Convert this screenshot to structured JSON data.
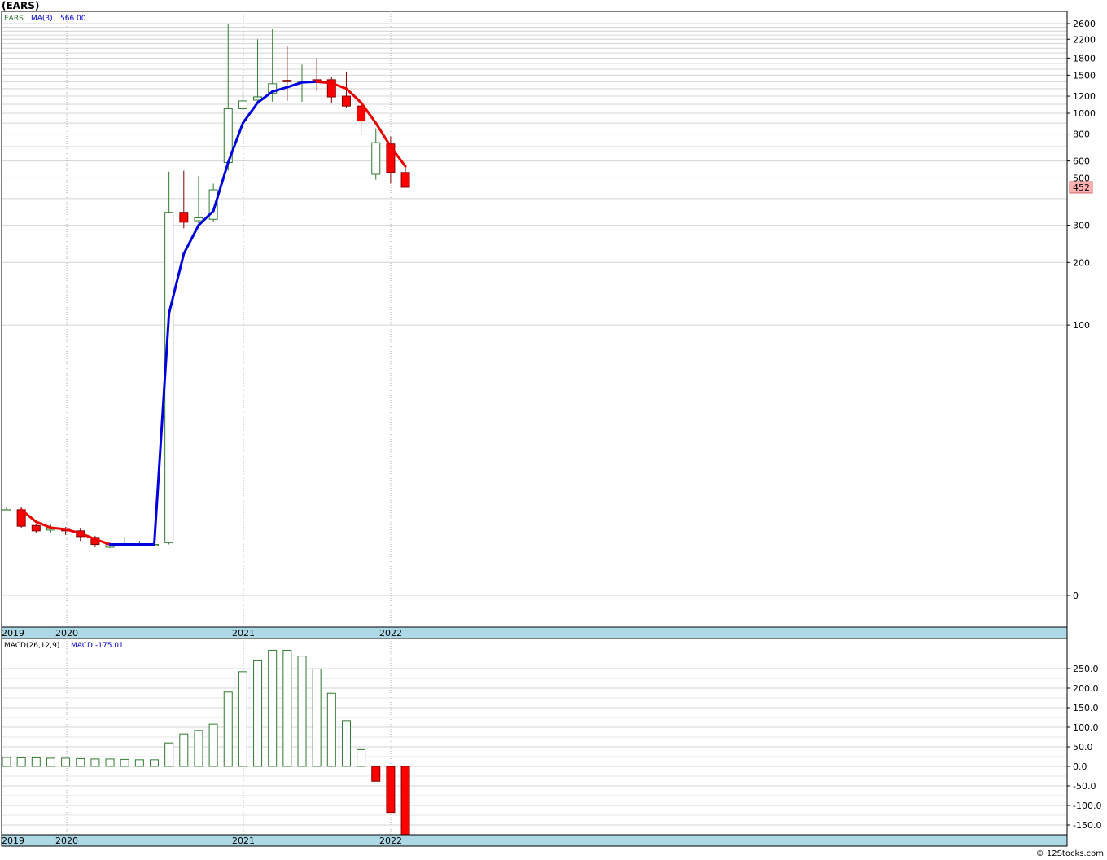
{
  "title": "(EARS)",
  "footer": "© 12Stocks.com",
  "colors": {
    "up_candle": "#2f7a2f",
    "down_candle": "#ff0000",
    "ma_up": "#0000dd",
    "ma_down": "#ee0000",
    "axis_band": "#add8e6",
    "grid": "#c8c8c8",
    "price_badge": "#ffb0b0"
  },
  "chart_data": [
    {
      "type": "candlestick",
      "legend": {
        "symbol": "EARS",
        "ma_label": "MA(3)",
        "ma_value": "566.00"
      },
      "last_price_label": "452",
      "scale": "log",
      "y_ticks": [
        "2600",
        "2200",
        "1800",
        "1500",
        "1200",
        "1000",
        "800",
        "600",
        "500",
        "300",
        "200",
        "100",
        "0"
      ],
      "x_labels": [
        "2019",
        "2020",
        "2021",
        "2022"
      ],
      "candles": [
        {
          "date": "2018-12",
          "open": 8.9,
          "high": 9.3,
          "low": 8.7,
          "close": 8.9
        },
        {
          "date": "2019-01",
          "open": 8.9,
          "high": 9.3,
          "low": 6.3,
          "close": 6.5
        },
        {
          "date": "2019-02",
          "open": 6.6,
          "high": 6.8,
          "low": 5.6,
          "close": 5.9
        },
        {
          "date": "2019-03",
          "open": 6.0,
          "high": 6.7,
          "low": 5.7,
          "close": 6.3
        },
        {
          "date": "2019-04",
          "open": 6.2,
          "high": 6.4,
          "low": 5.4,
          "close": 5.9
        },
        {
          "date": "2019-05",
          "open": 5.9,
          "high": 6.3,
          "low": 4.7,
          "close": 5.2
        },
        {
          "date": "2019-06",
          "open": 5.1,
          "high": 5.3,
          "low": 4.0,
          "close": 4.3
        },
        {
          "date": "2019-07",
          "open": 4.0,
          "high": 4.6,
          "low": 3.9,
          "close": 4.3
        },
        {
          "date": "2019-08",
          "open": 4.2,
          "high": 5.2,
          "low": 4.1,
          "close": 4.4
        },
        {
          "date": "2019-09",
          "open": 4.3,
          "high": 4.7,
          "low": 4.2,
          "close": 4.3
        },
        {
          "date": "2019-10",
          "open": 4.3,
          "high": 4.6,
          "low": 4.1,
          "close": 4.3
        },
        {
          "date": "2020-01",
          "open": 4.5,
          "high": 535,
          "low": 4.3,
          "close": 345
        },
        {
          "date": "2020-02",
          "open": 345,
          "high": 540,
          "low": 290,
          "close": 310
        },
        {
          "date": "2020-03",
          "open": 315,
          "high": 510,
          "low": 305,
          "close": 325
        },
        {
          "date": "2020-04",
          "open": 320,
          "high": 470,
          "low": 310,
          "close": 440
        },
        {
          "date": "2020-05",
          "open": 590,
          "high": 2600,
          "low": 540,
          "close": 1050
        },
        {
          "date": "2020-06",
          "open": 1050,
          "high": 1500,
          "low": 1000,
          "close": 1140
        },
        {
          "date": "2020-07",
          "open": 1150,
          "high": 2200,
          "low": 1130,
          "close": 1190
        },
        {
          "date": "2020-08",
          "open": 1240,
          "high": 2450,
          "low": 1130,
          "close": 1370
        },
        {
          "date": "2020-09",
          "open": 1420,
          "high": 2050,
          "low": 1140,
          "close": 1400
        },
        {
          "date": "2020-10",
          "open": 1400,
          "high": 1680,
          "low": 1130,
          "close": 1400
        },
        {
          "date": "2020-11",
          "open": 1430,
          "high": 1800,
          "low": 1270,
          "close": 1410
        },
        {
          "date": "2020-12",
          "open": 1430,
          "high": 1480,
          "low": 1120,
          "close": 1190
        },
        {
          "date": "2021-01",
          "open": 1200,
          "high": 1560,
          "low": 1060,
          "close": 1080
        },
        {
          "date": "2021-02",
          "open": 1080,
          "high": 1100,
          "low": 790,
          "close": 920
        },
        {
          "date": "2021-03",
          "open": 520,
          "high": 850,
          "low": 490,
          "close": 730
        },
        {
          "date": "2021-04",
          "open": 720,
          "high": 780,
          "low": 470,
          "close": 530
        },
        {
          "date": "2021-05",
          "open": 530,
          "high": 570,
          "low": 450,
          "close": 452
        }
      ],
      "ma": [
        null,
        8.9,
        7.1,
        6.3,
        6.1,
        5.6,
        4.9,
        4.3,
        4.3,
        4.3,
        4.3,
        114,
        220,
        300,
        350,
        590,
        900,
        1120,
        1260,
        1320,
        1390,
        1400,
        1380,
        1300,
        1120,
        900,
        700,
        566
      ]
    },
    {
      "type": "bar",
      "legend": {
        "label": "MACD(26,12,9)",
        "value_label": "MACD:-175.01"
      },
      "y_ticks": [
        "250.0",
        "200.0",
        "150.0",
        "100.0",
        "50.0",
        "0.0",
        "-50.0",
        "-100.0",
        "-150.0"
      ],
      "x_labels": [
        "2019",
        "2020",
        "2021",
        "2022"
      ],
      "values": [
        23,
        22,
        22,
        21,
        21,
        20,
        19,
        19,
        18,
        17,
        17,
        60,
        83,
        92,
        108,
        190,
        242,
        270,
        297,
        297,
        282,
        249,
        187,
        117,
        43,
        -38,
        -118,
        -175
      ]
    }
  ]
}
